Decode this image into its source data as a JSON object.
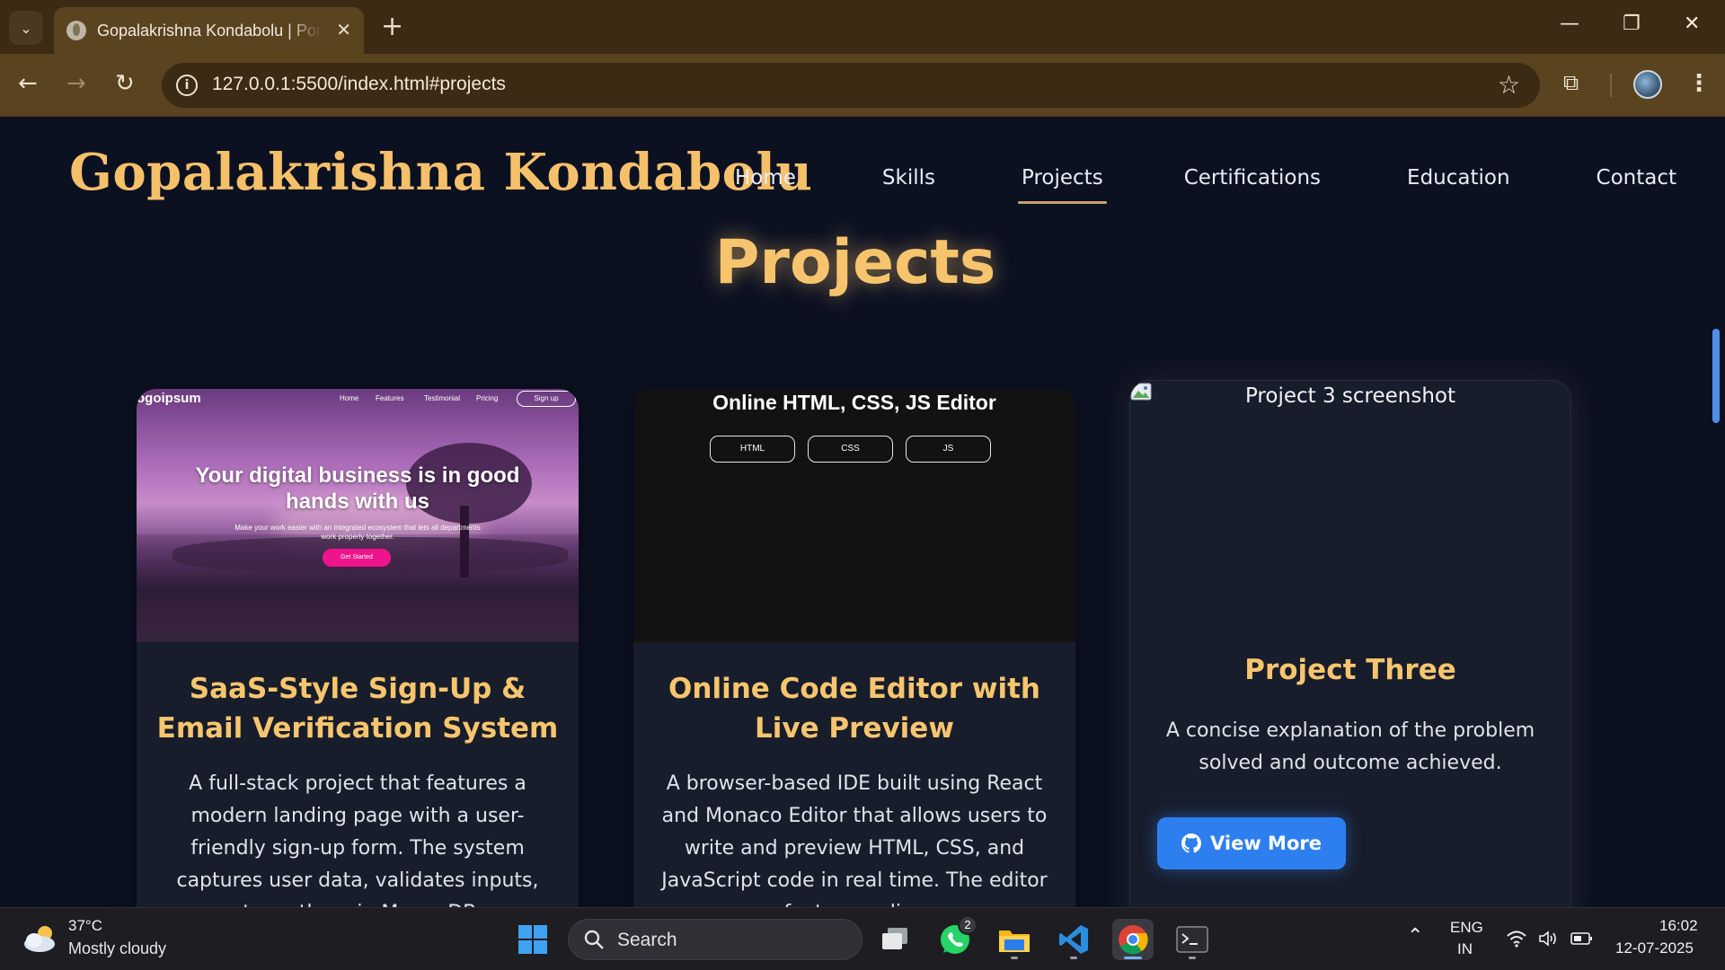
{
  "browser": {
    "tab_title": "Gopalakrishna Kondabolu | Portfolio",
    "url_host": "127.0.0.1",
    "url_rest": ":5500/index.html#projects"
  },
  "site": {
    "brand": "Gopalakrishna Kondabolu",
    "nav": [
      "Home",
      "Skills",
      "Projects",
      "Certifications",
      "Education",
      "Contact"
    ],
    "active_nav": "Projects",
    "section_title": "Projects"
  },
  "projects": [
    {
      "title": "SaaS-Style Sign-Up & Email Verification System",
      "description": "A full-stack project that features a modern landing page with a user-friendly sign-up form. The system captures user data, validates inputs, stores them in MongoDB,",
      "thumb": {
        "logo": "ogoipsum",
        "nav": [
          "Home",
          "Features",
          "Testimonial",
          "Pricing"
        ],
        "signup": "Sign up",
        "hero": "Your digital business is in good hands with us",
        "sub": "Make your work easier with an integrated ecosystem that lets all departments work properly together.",
        "cta": "Get Started"
      }
    },
    {
      "title": "Online Code Editor with Live Preview",
      "description": "A browser-based IDE built using React and Monaco Editor that allows users to write and preview HTML, CSS, and JavaScript code in real time. The editor features a live",
      "thumb": {
        "title": "Online HTML, CSS, JS Editor",
        "buttons": [
          "HTML",
          "CSS",
          "JS"
        ]
      }
    },
    {
      "title": "Project Three",
      "description": "A concise explanation of the problem solved and outcome achieved.",
      "image_alt": "Project 3 screenshot",
      "button": "View More"
    }
  ],
  "taskbar": {
    "temperature": "37°C",
    "condition": "Mostly cloudy",
    "search": "Search",
    "whatsapp_badge": "2",
    "lang1": "ENG",
    "lang2": "IN",
    "time": "16:02",
    "date": "12-07-2025"
  },
  "colors": {
    "accent": "#f6c56e",
    "button": "#2d7ff0",
    "page_bg": "#0c1122",
    "chrome": "#5a4420"
  }
}
